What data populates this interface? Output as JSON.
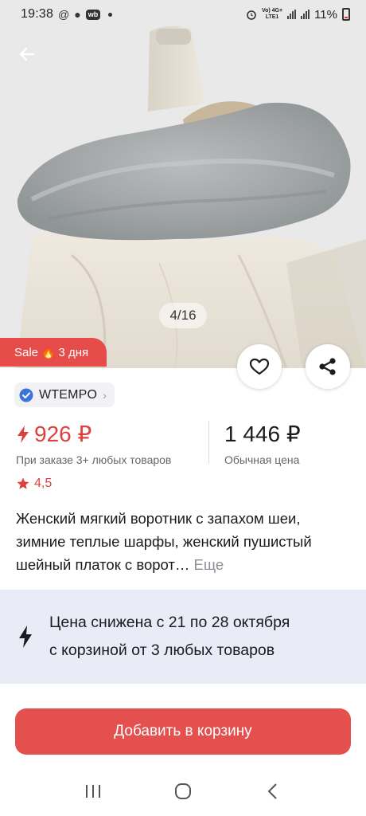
{
  "status_bar": {
    "time": "19:38",
    "network": "Vo) 4G+\nLTE1",
    "battery": "11%"
  },
  "image_counter": "4/16",
  "sale_badge": {
    "label": "Sale",
    "emoji": "🔥",
    "duration": "3 дня"
  },
  "brand": {
    "name": "WTEMPO"
  },
  "price": {
    "sale_value": "926 ₽",
    "sale_caption": "При заказе 3+ любых товаров",
    "regular_value": "1 446 ₽",
    "regular_caption": "Обычная цена"
  },
  "rating": "4,5",
  "product": {
    "title": "Женский мягкий воротник с запахом шеи, зимние теплые шарфы, женский пушистый шейный платок с ворот…",
    "more_label": "Еще"
  },
  "promo": {
    "line1": "Цена снижена с 21 по 28 октября",
    "line2": "с корзиной от 3 любых товаров"
  },
  "add_to_cart": "Добавить в корзину",
  "colors": {
    "accent": "#e4504d",
    "price_red": "#e0403d",
    "promo_bg": "#e9ecf7",
    "brand_check": "#3a74d8"
  }
}
